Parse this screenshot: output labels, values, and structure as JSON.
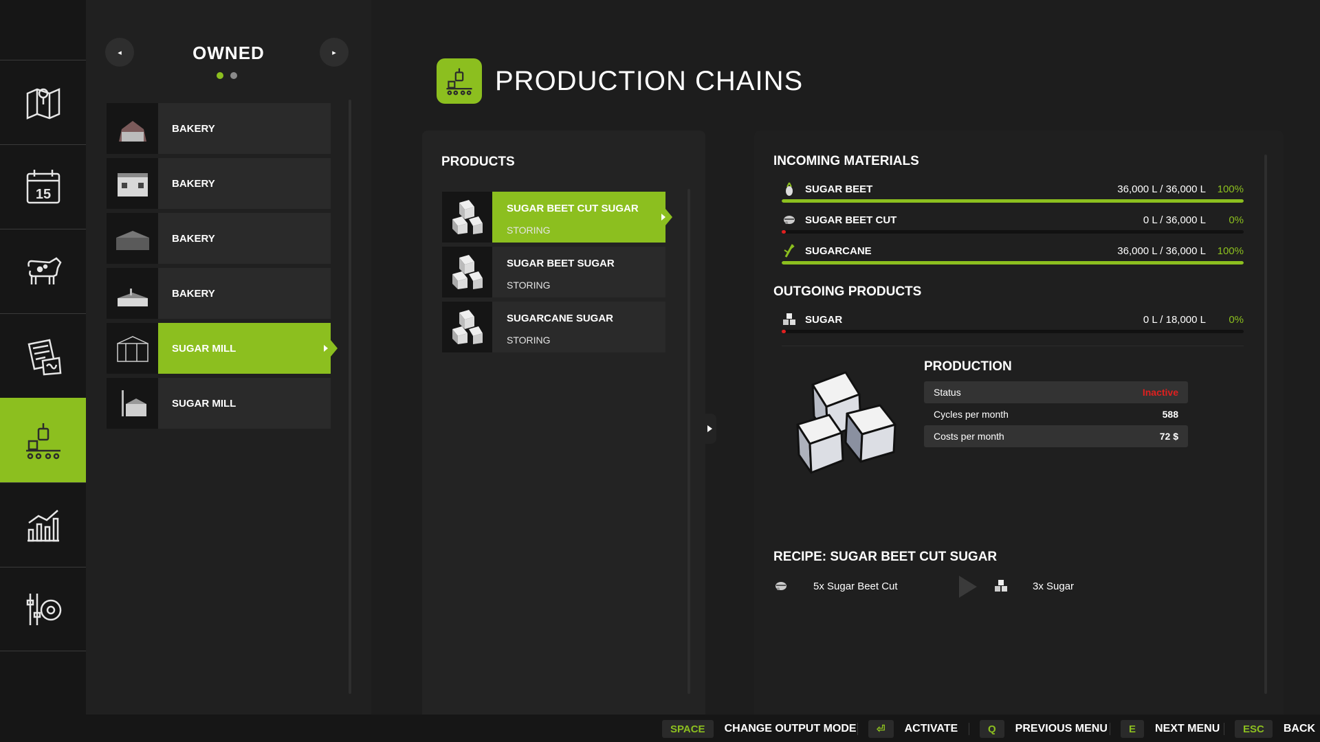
{
  "nav": {
    "items": [
      {
        "icon": "map-icon"
      },
      {
        "icon": "calendar-icon",
        "badge": "15"
      },
      {
        "icon": "cow-icon"
      },
      {
        "icon": "contracts-icon"
      },
      {
        "icon": "production-icon",
        "active": true
      },
      {
        "icon": "statistics-icon"
      },
      {
        "icon": "settings-icon"
      }
    ]
  },
  "owned": {
    "title": "OWNED",
    "prev_icon": "◂",
    "next_icon": "▸",
    "page_count": 2,
    "current_page": 1,
    "items": [
      {
        "label": "BAKERY"
      },
      {
        "label": "BAKERY"
      },
      {
        "label": "BAKERY"
      },
      {
        "label": "BAKERY"
      },
      {
        "label": "SUGAR MILL",
        "active": true
      },
      {
        "label": "SUGAR MILL"
      }
    ]
  },
  "header": {
    "title": "PRODUCTION CHAINS"
  },
  "products": {
    "title": "PRODUCTS",
    "items": [
      {
        "name": "SUGAR BEET CUT SUGAR",
        "mode": "STORING",
        "active": true
      },
      {
        "name": "SUGAR BEET SUGAR",
        "mode": "STORING"
      },
      {
        "name": "SUGARCANE SUGAR",
        "mode": "STORING"
      }
    ]
  },
  "incoming": {
    "title": "INCOMING MATERIALS",
    "items": [
      {
        "name": "SUGAR BEET",
        "value": "36,000 L / 36,000 L",
        "percent": "100%",
        "fill": 1.0
      },
      {
        "name": "SUGAR BEET CUT",
        "value": "0 L / 36,000 L",
        "percent": "0%",
        "fill": 0.0
      },
      {
        "name": "SUGARCANE",
        "value": "36,000 L / 36,000 L",
        "percent": "100%",
        "fill": 1.0
      }
    ]
  },
  "outgoing": {
    "title": "OUTGOING PRODUCTS",
    "items": [
      {
        "name": "SUGAR",
        "value": "0 L / 18,000 L",
        "percent": "0%",
        "fill": 0.0
      }
    ]
  },
  "production": {
    "title": "PRODUCTION",
    "status_label": "Status",
    "status_value": "Inactive",
    "cycles_label": "Cycles per month",
    "cycles_value": "588",
    "costs_label": "Costs per month",
    "costs_value": "72 $"
  },
  "recipe": {
    "title": "RECIPE: SUGAR BEET CUT SUGAR",
    "input": "5x Sugar Beet Cut",
    "output": "3x Sugar"
  },
  "footer": {
    "hints": [
      {
        "key": "SPACE",
        "label": "CHANGE OUTPUT MODE"
      },
      {
        "key": "⏎",
        "label": "ACTIVATE"
      },
      {
        "key": "Q",
        "label": "PREVIOUS MENU"
      },
      {
        "key": "E",
        "label": "NEXT MENU"
      },
      {
        "key": "ESC",
        "label": "BACK"
      }
    ]
  },
  "colors": {
    "accent": "#8cbf1f",
    "inactive": "#e0201f",
    "panel": "#232323",
    "background": "#1d1d1d"
  }
}
